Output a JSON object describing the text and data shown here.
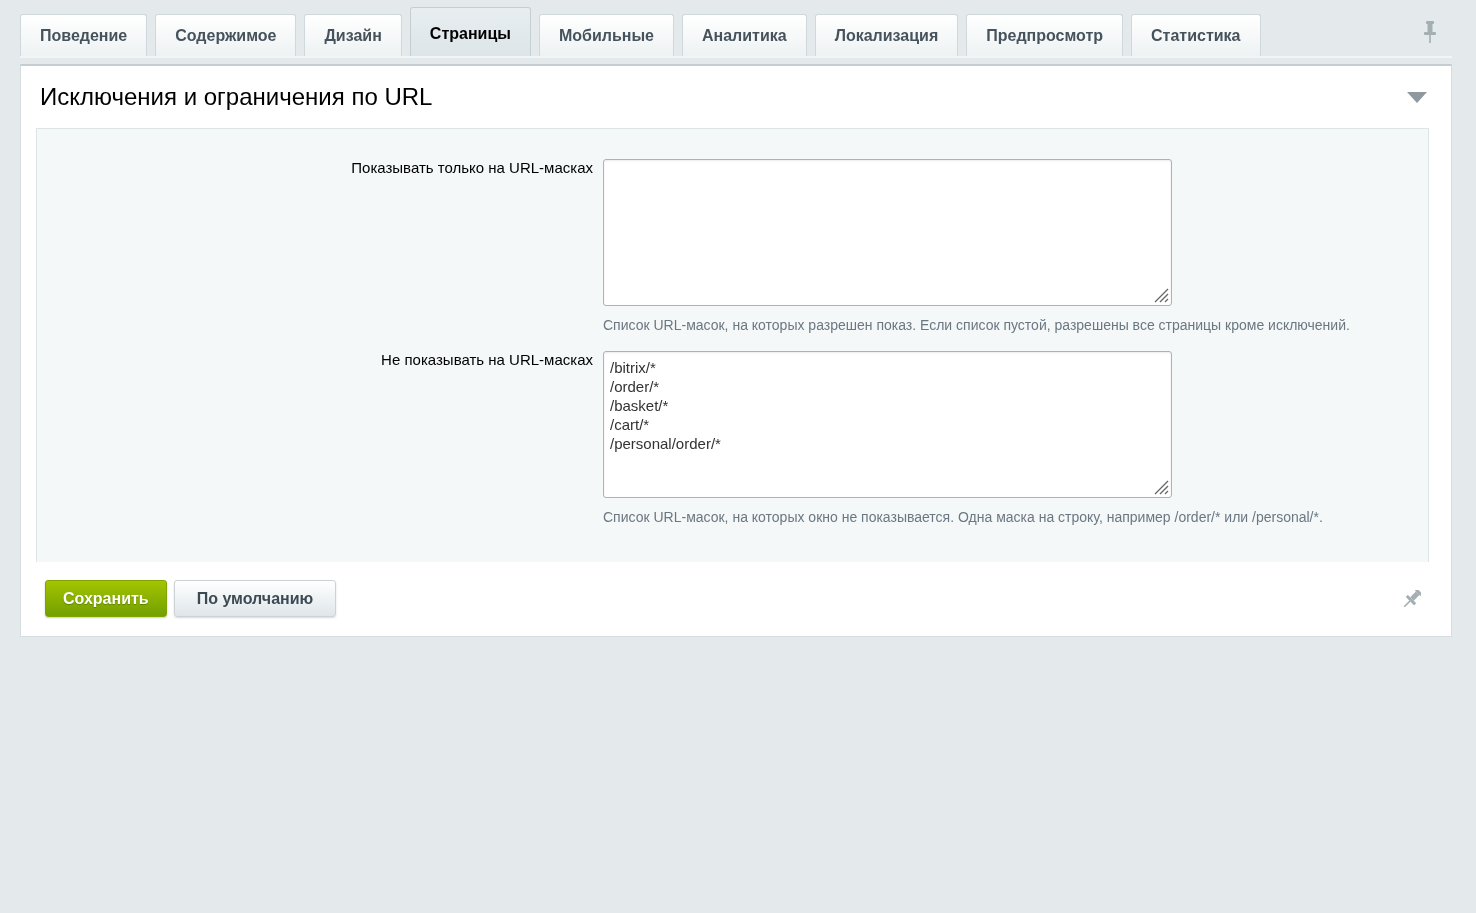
{
  "tabs": [
    {
      "label": "Поведение",
      "selected": false
    },
    {
      "label": "Содержимое",
      "selected": false
    },
    {
      "label": "Дизайн",
      "selected": false
    },
    {
      "label": "Страницы",
      "selected": true
    },
    {
      "label": "Мобильные",
      "selected": false
    },
    {
      "label": "Аналитика",
      "selected": false
    },
    {
      "label": "Локализация",
      "selected": false
    },
    {
      "label": "Предпросмотр",
      "selected": false
    },
    {
      "label": "Статистика",
      "selected": false
    }
  ],
  "section": {
    "title": "Исключения и ограничения по URL",
    "expanded": true,
    "fields": [
      {
        "label": "Показывать только на URL-масках",
        "hint": "Список URL-масок, на которых разрешен показ. Если список пустой, разрешены все страницы кроме исключений."
      },
      {
        "label": "Не показывать на URL-масках",
        "value": "/bitrix/*\n/order/*\n/basket/*\n/cart/*\n/personal/order/*",
        "hint": "Список URL-масок, на которых окно не показывается. Одна маска на строку, например /order/* или /personal/*."
      }
    ]
  },
  "buttons": [
    {
      "label": "Сохранить",
      "kind": "primary"
    },
    {
      "label": "По умолчанию",
      "kind": "default"
    }
  ]
}
